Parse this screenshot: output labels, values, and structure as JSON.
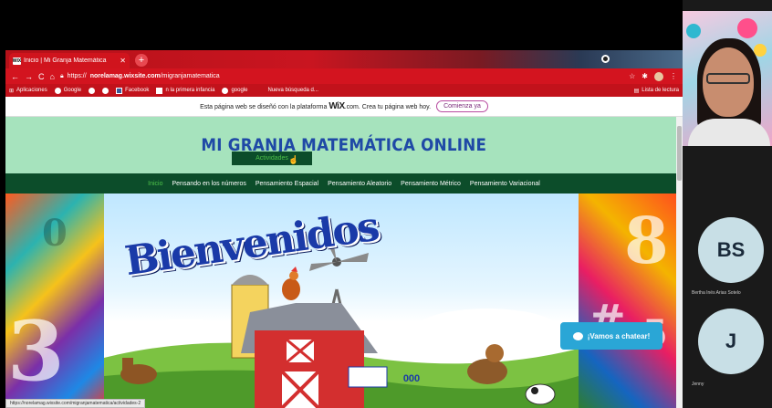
{
  "browser": {
    "tab_title": "Inicio | Mi Granja Matemática",
    "tab_favicon": "WIX",
    "new_tab": "+",
    "url_prefix": "https://",
    "url_domain": "norelamag.wixsite.com",
    "url_path": "/migranjamatematica",
    "bookmarks": [
      "Aplicaciones",
      "Google",
      "Facebook",
      "n la primera infancia",
      "google",
      "Nueva búsqueda d..."
    ],
    "reading_list": "Lista de lectura",
    "status_url": "https://norelamag.wixsite.com/migranjamatematica/actividades-2"
  },
  "wix_banner": {
    "text_before": "Esta página web se diseñó con la plataforma",
    "brand": "WiX",
    "text_after": ".com. Crea tu página web hoy.",
    "cta": "Comienza ya"
  },
  "site": {
    "title": "MI GRANJA MATEMÁTICA ONLINE",
    "nav": [
      "Inicio",
      "Pensando en los números",
      "Pensamiento Espacial",
      "Pensamiento Aleatorio",
      "Pensamiento Métrico",
      "Pensamiento Variacional"
    ],
    "dropdown_item": "Actividades",
    "welcome": "Bienvenidos",
    "barn_sign": "000",
    "chat_button": "¡Vamos a chatear!"
  },
  "video_panel": {
    "participants": [
      {
        "initials": "BS",
        "name": "Bertha Inés Arias Sotelo"
      },
      {
        "initials": "J",
        "name": "Jenny"
      }
    ]
  },
  "colors": {
    "browser_red": "#d3141f",
    "header_mint": "#a6e3bd",
    "title_blue": "#1f49a6",
    "nav_green": "#0c4d2a",
    "nav_active": "#4ec24a",
    "chat_blue": "#2aa6d6"
  }
}
